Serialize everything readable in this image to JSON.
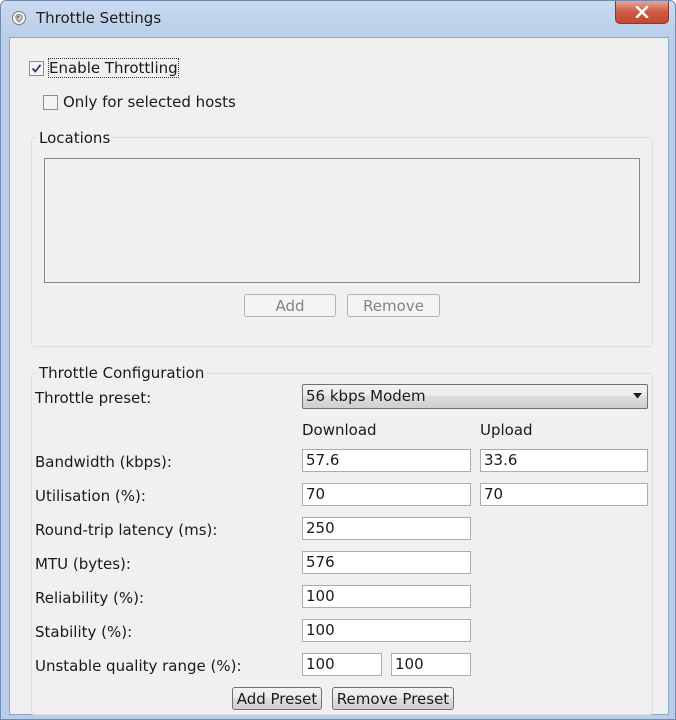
{
  "window": {
    "title": "Throttle Settings",
    "app_icon": "app-icon",
    "close_icon": "close-icon",
    "accent_color": "#c7412b"
  },
  "options": {
    "enable_throttling": {
      "label": "Enable Throttling",
      "checked": true
    },
    "only_selected_hosts": {
      "label": "Only for selected hosts",
      "checked": false
    }
  },
  "locations": {
    "title": "Locations",
    "add_label": "Add",
    "remove_label": "Remove"
  },
  "config": {
    "title": "Throttle Configuration",
    "preset_label": "Throttle preset:",
    "preset_value": "56 kbps Modem",
    "download_header": "Download",
    "upload_header": "Upload",
    "bandwidth_label": "Bandwidth (kbps):",
    "bandwidth_download": "57.6",
    "bandwidth_upload": "33.6",
    "utilisation_label": "Utilisation (%):",
    "utilisation_download": "70",
    "utilisation_upload": "70",
    "latency_label": "Round-trip latency (ms):",
    "latency_value": "250",
    "mtu_label": "MTU (bytes):",
    "mtu_value": "576",
    "reliability_label": "Reliability (%):",
    "reliability_value": "100",
    "stability_label": "Stability (%):",
    "stability_value": "100",
    "unstable_label": "Unstable quality range (%):",
    "unstable_min": "100",
    "unstable_max": "100",
    "add_preset_label": "Add Preset",
    "remove_preset_label": "Remove Preset"
  }
}
